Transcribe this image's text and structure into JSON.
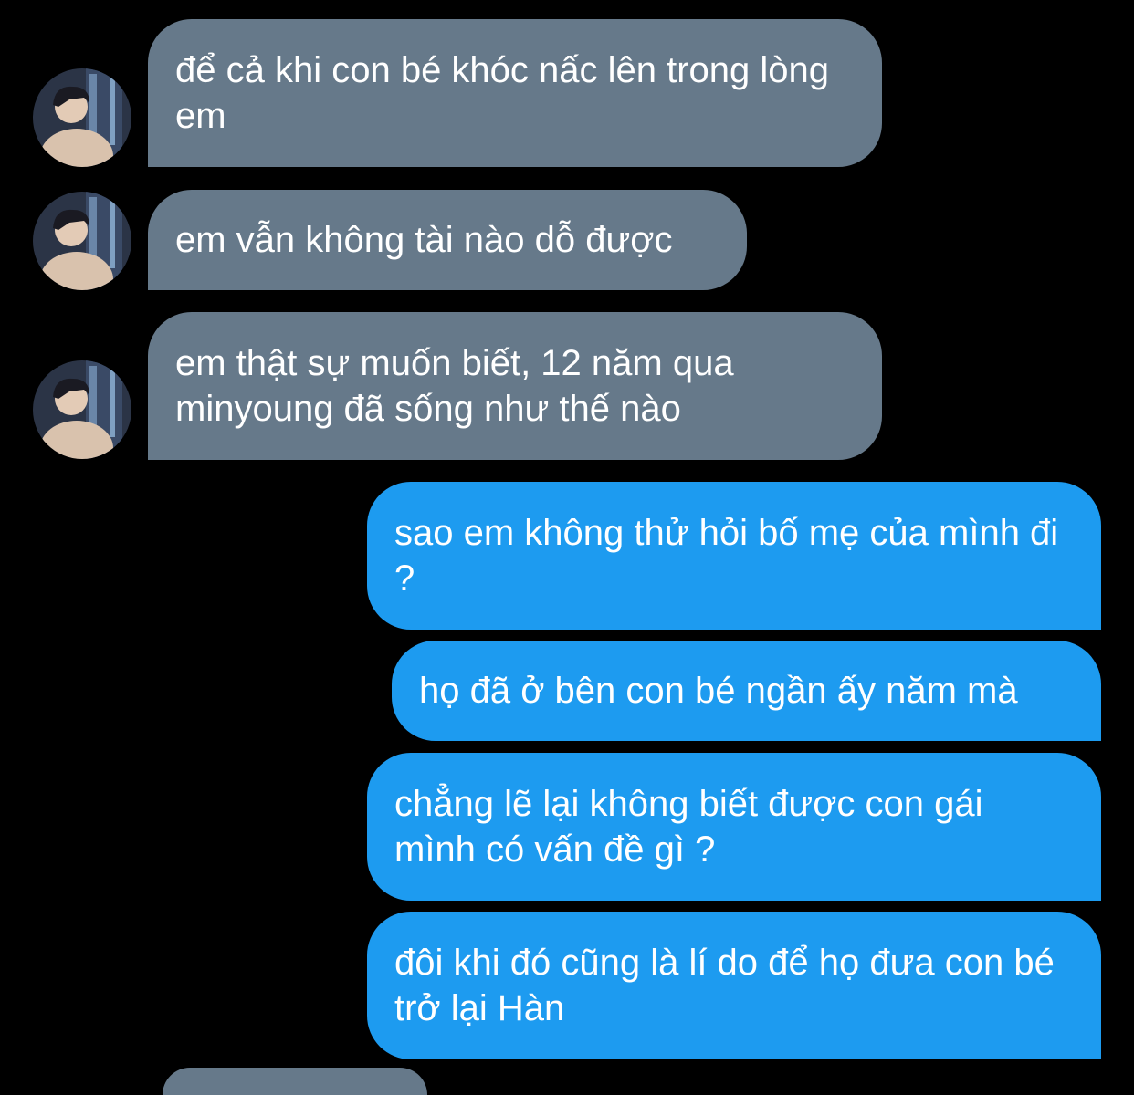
{
  "conversation": {
    "messages": [
      {
        "direction": "incoming",
        "text": "để cả khi con bé khóc nấc lên trong lòng em"
      },
      {
        "direction": "incoming",
        "text": "em vẫn không tài nào dỗ được"
      },
      {
        "direction": "incoming",
        "text": "em thật sự muốn biết, 12 năm qua minyoung đã sống như thế nào"
      },
      {
        "direction": "outgoing",
        "text": "sao em không thử hỏi bố mẹ của mình đi ?"
      },
      {
        "direction": "outgoing",
        "text": "họ đã ở bên con bé ngần ấy năm mà"
      },
      {
        "direction": "outgoing",
        "text": "chẳng lẽ lại không biết được con gái mình có vấn đề gì ?"
      },
      {
        "direction": "outgoing",
        "text": "đôi khi đó cũng là lí do để họ đưa con bé trở lại Hàn"
      }
    ]
  },
  "colors": {
    "background": "#000000",
    "incoming_bubble": "#66798a",
    "outgoing_bubble": "#1d9bf0",
    "text": "#ffffff"
  }
}
